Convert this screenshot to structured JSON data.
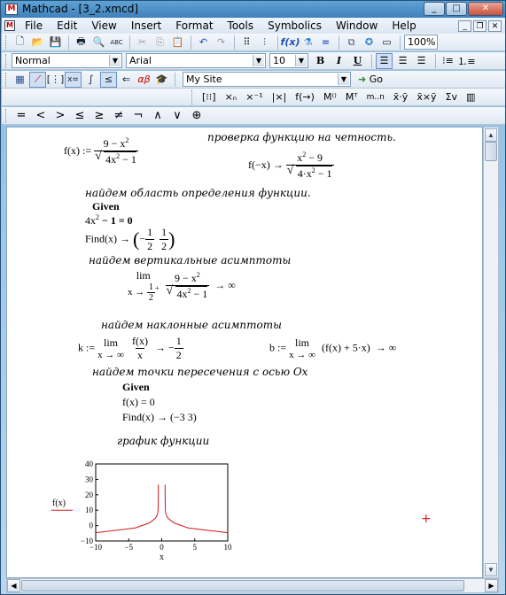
{
  "window": {
    "title": "Mathcad - [3_2.xmcd]",
    "icon": "mathcad-icon",
    "min": "_",
    "max": "□",
    "close": "✕"
  },
  "menu": [
    "File",
    "Edit",
    "View",
    "Insert",
    "Format",
    "Tools",
    "Symbolics",
    "Window",
    "Help"
  ],
  "toolbar": {
    "zoom": "100%"
  },
  "format_bar": {
    "style": "Normal",
    "font": "Arial",
    "size": "10",
    "bold": "B",
    "italic": "I",
    "underline": "U"
  },
  "resources": {
    "site": "My Site",
    "go": "Go"
  },
  "worksheet": {
    "f_def": {
      "lhs": "f(x) :=",
      "num": "9 − x",
      "den": "4x",
      "den_tail": " − 1"
    },
    "parity_text": "проверка функцию на четность.",
    "parity": {
      "lhs": "f(−x) →",
      "num": "x",
      "num_tail": " − 9",
      "den": "4·x",
      "den_tail": " − 1"
    },
    "domain_text": "найдем область определения функции.",
    "given1": "Given",
    "constraint": {
      "lhs": "4x",
      "rhs": " − 1 = 0"
    },
    "find1": {
      "lhs": "Find(x) →",
      "a_num": "1",
      "a_den": "2",
      "b_num": "1",
      "b_den": "2"
    },
    "vert_text": "найдем вертикальные асимптоты",
    "vert": {
      "lim": "lim",
      "sub": "x →",
      "sub_num": "1",
      "sub_den": "2",
      "num": "9 − x",
      "den": "4x",
      "den_tail": " − 1",
      "result": "→ ∞"
    },
    "oblique_text": "найдем наклонные асимптоты",
    "k": {
      "lhs": "k :=",
      "lim": "lim",
      "sub": "x → ∞",
      "num": "f(x)",
      "den": "x",
      "arrow": "→ −",
      "r_num": "1",
      "r_den": "2"
    },
    "b": {
      "lhs": "b :=",
      "lim": "lim",
      "sub": "x → ∞",
      "expr": "(f(x) + 5·x)",
      "result": "→ ∞"
    },
    "intersect_text": "найдем точки пересечения с осью Ох",
    "given2": "Given",
    "eq2": "f(x) = 0",
    "find2": "Find(x) → (−3   3)",
    "graph_text": "график функции"
  },
  "chart_data": {
    "type": "line",
    "title": "",
    "xlabel": "x",
    "ylabel": "f(x)",
    "xlim": [
      -10,
      10
    ],
    "ylim": [
      -10,
      40
    ],
    "xticks": [
      "−10",
      "−5",
      "0",
      "5",
      "10"
    ],
    "yticks": [
      "40",
      "30",
      "20",
      "10",
      "0",
      "−10"
    ],
    "series": [
      {
        "color": "#d01818",
        "x": [
          -10,
          -8,
          -6,
          -4,
          -3,
          -2,
          -1.5,
          -1,
          -0.8,
          -0.6,
          -0.55,
          -0.52,
          -0.51
        ],
        "y": [
          -4.6,
          -3.6,
          -2.6,
          -1.5,
          0,
          1.5,
          2.9,
          4.6,
          5.7,
          8.1,
          10.5,
          17.1,
          26.6
        ]
      },
      {
        "color": "#d01818",
        "x": [
          0.51,
          0.52,
          0.55,
          0.6,
          0.8,
          1,
          1.5,
          2,
          3,
          4,
          6,
          8,
          10
        ],
        "y": [
          26.6,
          17.1,
          10.5,
          8.1,
          5.7,
          4.6,
          2.9,
          1.5,
          0,
          -1.5,
          -2.6,
          -3.6,
          -4.6
        ]
      }
    ]
  }
}
